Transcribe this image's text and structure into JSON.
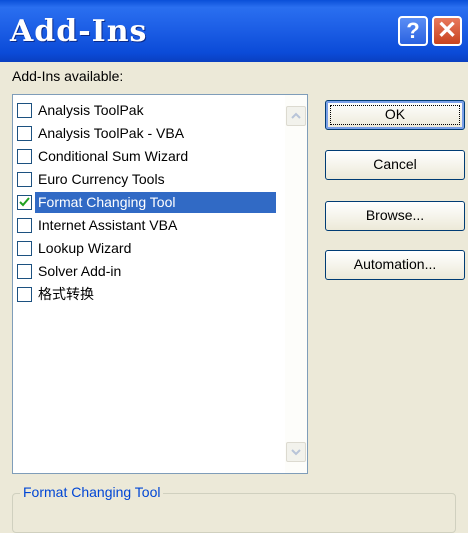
{
  "window": {
    "title": "Add-Ins",
    "help_label": "?",
    "close_label": "✕"
  },
  "addins_label": "Add-Ins available:",
  "addins": [
    {
      "label": "Analysis ToolPak",
      "checked": false,
      "selected": false
    },
    {
      "label": "Analysis ToolPak - VBA",
      "checked": false,
      "selected": false
    },
    {
      "label": "Conditional Sum Wizard",
      "checked": false,
      "selected": false
    },
    {
      "label": "Euro Currency Tools",
      "checked": false,
      "selected": false
    },
    {
      "label": "Format Changing Tool",
      "checked": true,
      "selected": true
    },
    {
      "label": "Internet Assistant VBA",
      "checked": false,
      "selected": false
    },
    {
      "label": "Lookup Wizard",
      "checked": false,
      "selected": false
    },
    {
      "label": "Solver Add-in",
      "checked": false,
      "selected": false
    },
    {
      "label": "格式转换",
      "checked": false,
      "selected": false
    }
  ],
  "buttons": {
    "ok": "OK",
    "cancel": "Cancel",
    "browse": "Browse...",
    "automation": "Automation..."
  },
  "description": {
    "title": "Format Changing Tool"
  }
}
